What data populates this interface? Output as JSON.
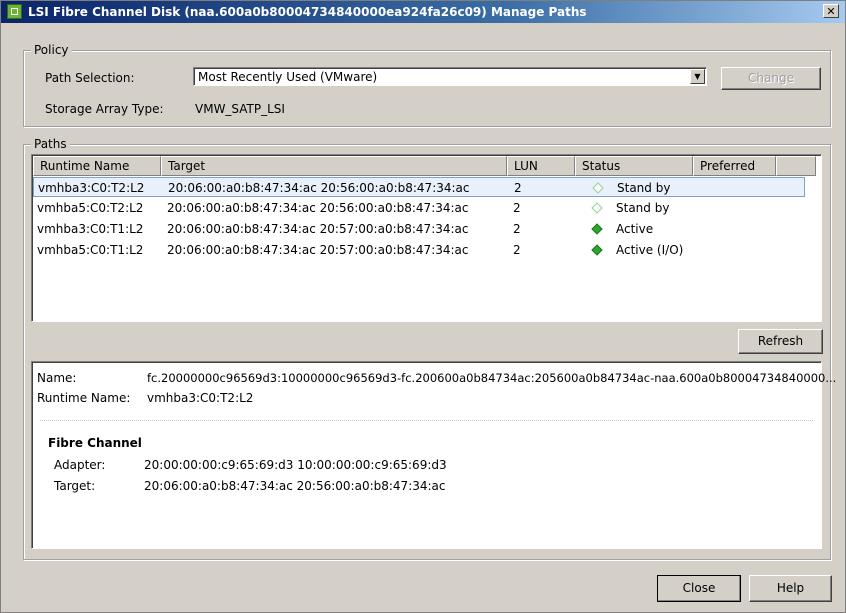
{
  "window": {
    "title": "LSI Fibre Channel Disk (naa.600a0b80004734840000ea924fa26c09) Manage Paths",
    "close_glyph": "✕"
  },
  "policy": {
    "legend": "Policy",
    "path_selection_label": "Path Selection:",
    "path_selection_value": "Most Recently Used (VMware)",
    "change_label": "Change",
    "storage_array_type_label": "Storage Array Type:",
    "storage_array_type_value": "VMW_SATP_LSI"
  },
  "paths": {
    "legend": "Paths",
    "columns": [
      "Runtime Name",
      "Target",
      "LUN",
      "Status",
      "Preferred"
    ],
    "rows": [
      {
        "runtime": "vmhba3:C0:T2:L2",
        "target": "20:06:00:a0:b8:47:34:ac 20:56:00:a0:b8:47:34:ac",
        "lun": "2",
        "status": "Stand by",
        "status_icon": "standby-diamond-icon",
        "selected": true
      },
      {
        "runtime": "vmhba5:C0:T2:L2",
        "target": "20:06:00:a0:b8:47:34:ac 20:56:00:a0:b8:47:34:ac",
        "lun": "2",
        "status": "Stand by",
        "status_icon": "standby-diamond-icon",
        "selected": false
      },
      {
        "runtime": "vmhba3:C0:T1:L2",
        "target": "20:06:00:a0:b8:47:34:ac 20:57:00:a0:b8:47:34:ac",
        "lun": "2",
        "status": "Active",
        "status_icon": "active-diamond-icon",
        "selected": false
      },
      {
        "runtime": "vmhba5:C0:T1:L2",
        "target": "20:06:00:a0:b8:47:34:ac 20:57:00:a0:b8:47:34:ac",
        "lun": "2",
        "status": "Active (I/O)",
        "status_icon": "active-diamond-icon",
        "selected": false
      }
    ],
    "refresh_label": "Refresh"
  },
  "details": {
    "name_label": "Name:",
    "name_value": "fc.20000000c96569d3:10000000c96569d3-fc.200600a0b84734ac:205600a0b84734ac-naa.600a0b80004734840000...",
    "runtime_label": "Runtime Name:",
    "runtime_value": "vmhba3:C0:T2:L2",
    "section_title": "Fibre Channel",
    "adapter_label": "Adapter:",
    "adapter_value": "20:00:00:00:c9:65:69:d3 10:00:00:00:c9:65:69:d3",
    "target_label": "Target:",
    "target_value": "20:06:00:a0:b8:47:34:ac 20:56:00:a0:b8:47:34:ac"
  },
  "footer": {
    "close_label": "Close",
    "help_label": "Help"
  },
  "colors": {
    "standby": "#8fd08f",
    "active": "#2ea32e",
    "titlebar": "#0a246a"
  }
}
